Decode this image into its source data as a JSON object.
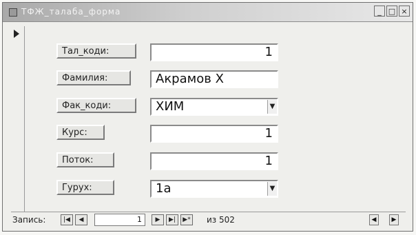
{
  "window": {
    "title": "ТФЖ_талаба_форма",
    "controls": [
      "_",
      "□",
      "×"
    ]
  },
  "form": {
    "fields": [
      {
        "label": "Тал_коди:",
        "value": "1",
        "align": "right",
        "dropdown": false
      },
      {
        "label": "Фамилия:",
        "value": "Акрамов Х",
        "align": "left",
        "dropdown": false
      },
      {
        "label": "Фак_коди:",
        "value": "ХИМ",
        "align": "left",
        "dropdown": true
      },
      {
        "label": "Курс:",
        "value": "1",
        "align": "right",
        "dropdown": false
      },
      {
        "label": "Поток:",
        "value": "1",
        "align": "right",
        "dropdown": false
      },
      {
        "label": "Гурух:",
        "value": "1a",
        "align": "left",
        "dropdown": true
      }
    ]
  },
  "navigation": {
    "record_label": "Запись:",
    "first": "|◀",
    "prev": "◀",
    "current": "1",
    "next": "▶",
    "last": "▶|",
    "new": "▶*",
    "total_text": "из 502",
    "scroll_left": "◀",
    "scroll_right": "▶"
  }
}
